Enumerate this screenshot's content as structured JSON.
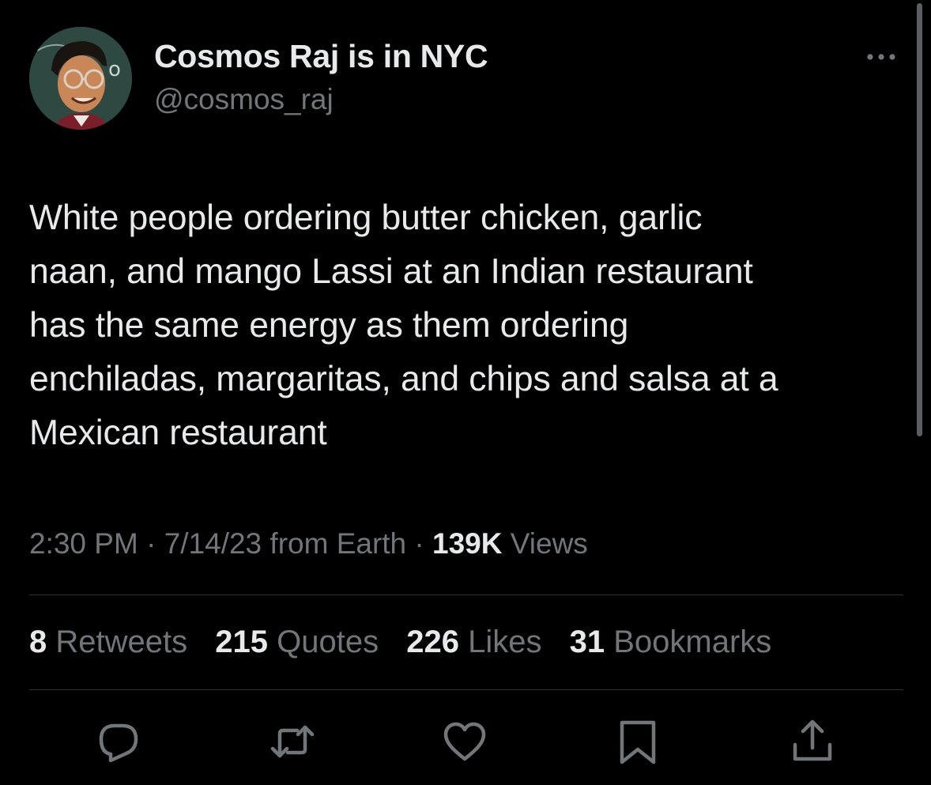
{
  "author": {
    "display_name": "Cosmos Raj is in NYC",
    "handle": "@cosmos_raj",
    "avatar_icon": "cartoon-avatar"
  },
  "tweet": {
    "text": "White people ordering butter chicken, garlic\nnaan, and mango Lassi at an Indian restaurant\nhas the same energy as them ordering\nenchiladas, margaritas, and chips and salsa at a\nMexican restaurant"
  },
  "meta": {
    "time": "2:30 PM",
    "sep1": " · ",
    "date": "7/14/23",
    "source": " from Earth",
    "sep2": " · ",
    "views_count": "139K",
    "views_label": " Views"
  },
  "stats": {
    "retweets_count": "8",
    "retweets_label": "Retweets",
    "quotes_count": "215",
    "quotes_label": "Quotes",
    "likes_count": "226",
    "likes_label": "Likes",
    "bookmarks_count": "31",
    "bookmarks_label": "Bookmarks"
  },
  "actions": {
    "icons": [
      "reply-icon",
      "retweet-icon",
      "like-icon",
      "bookmark-icon",
      "share-icon"
    ]
  },
  "colors": {
    "background": "#000000",
    "primary_text": "#e7e9ea",
    "secondary_text": "#71767b",
    "divider": "#2f3336"
  }
}
